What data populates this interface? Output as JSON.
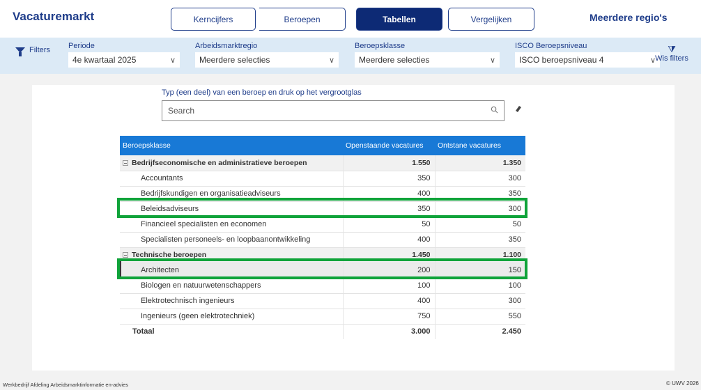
{
  "header": {
    "brand": "Vacaturemarkt",
    "nav": [
      "Kerncijfers",
      "Beroepen",
      "Tabellen",
      "Vergelijken"
    ],
    "active_tab": "Tabellen",
    "region_link": "Meerdere regio's"
  },
  "filters": {
    "button_label": "Filters",
    "clear_label": "Wis filters",
    "groups": [
      {
        "label": "Periode",
        "value": "4e kwartaal 2025"
      },
      {
        "label": "Arbeidsmarktregio",
        "value": "Meerdere selecties"
      },
      {
        "label": "Beroepsklasse",
        "value": "Meerdere selecties"
      },
      {
        "label": "ISCO Beroepsniveau",
        "value": "ISCO beroepsniveau 4"
      }
    ]
  },
  "search": {
    "hint": "Typ (een deel) van een beroep en druk op het vergrootglas",
    "placeholder": "Search"
  },
  "table": {
    "columns": [
      "Beroepsklasse",
      "Openstaande vacatures",
      "Ontstane vacatures"
    ],
    "rows": [
      {
        "label": "Bedrijfseconomische en administratieve beroepen",
        "open": "1.550",
        "new": "1.350"
      },
      {
        "label": "Accountants",
        "open": "350",
        "new": "300"
      },
      {
        "label": "Bedrijfskundigen en organisatieadviseurs",
        "open": "400",
        "new": "350"
      },
      {
        "label": "Beleidsadviseurs",
        "open": "350",
        "new": "300"
      },
      {
        "label": "Financieel specialisten en economen",
        "open": "50",
        "new": "50"
      },
      {
        "label": "Specialisten personeels- en loopbaanontwikkeling",
        "open": "400",
        "new": "350"
      },
      {
        "label": "Technische beroepen",
        "open": "1.450",
        "new": "1.100"
      },
      {
        "label": "Architecten",
        "open": "200",
        "new": "150"
      },
      {
        "label": "Biologen en natuurwetenschappers",
        "open": "100",
        "new": "100"
      },
      {
        "label": "Elektrotechnisch ingenieurs",
        "open": "400",
        "new": "300"
      },
      {
        "label": "Ingenieurs (geen elektrotechniek)",
        "open": "750",
        "new": "550"
      },
      {
        "label": "Totaal",
        "open": "3.000",
        "new": "2.450"
      }
    ]
  },
  "footer": {
    "left": "Werkbedrijf Afdeling Arbeidsmarktinformatie en-advies",
    "right": "© UWV 2026"
  },
  "colors": {
    "brand": "#1f3d8a",
    "active_tab": "#0d2a75",
    "table_header": "#1879d6",
    "highlight": "#10a33a",
    "filterbar": "#dceaf6"
  }
}
